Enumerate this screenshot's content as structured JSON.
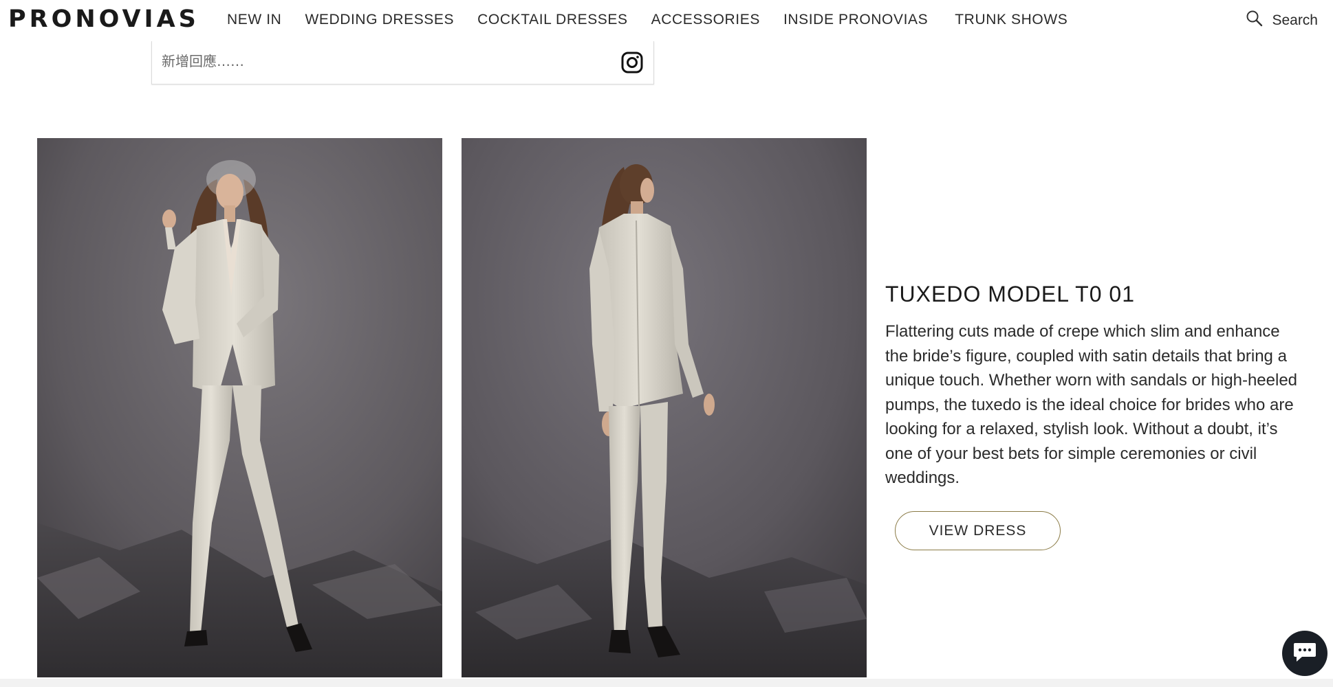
{
  "header": {
    "logo": "PRONOVIAS",
    "nav": [
      {
        "label": "NEW IN"
      },
      {
        "label": "WEDDING DRESSES"
      },
      {
        "label": "COCKTAIL DRESSES"
      },
      {
        "label": "ACCESSORIES"
      },
      {
        "label": "INSIDE PRONOVIAS"
      },
      {
        "label": "TRUNK SHOWS"
      }
    ],
    "search_label": "Search",
    "search_icon": "search-icon"
  },
  "comment": {
    "placeholder": "新增回應……",
    "icon": "instagram-icon"
  },
  "photos": [
    {
      "alt": "Model wearing ivory tuxedo, front view"
    },
    {
      "alt": "Model wearing ivory tuxedo, back view"
    }
  ],
  "product": {
    "title": "TUXEDO MODEL T0 01",
    "description": "Flattering cuts made of crepe which slim and enhance the bride’s figure, coupled with satin details that bring a unique touch. Whether worn with sandals or high-heeled pumps, the tuxedo is the ideal choice for brides who are looking for a relaxed, stylish look. Without a doubt, it’s one of your best bets for simple ceremonies or civil weddings.",
    "button_label": "VIEW DRESS"
  },
  "chat": {
    "icon": "chat-icon"
  },
  "colors": {
    "accent_border": "#8a7a45",
    "photo_background": "#5f5b60",
    "chat_button": "#1a1f26"
  }
}
